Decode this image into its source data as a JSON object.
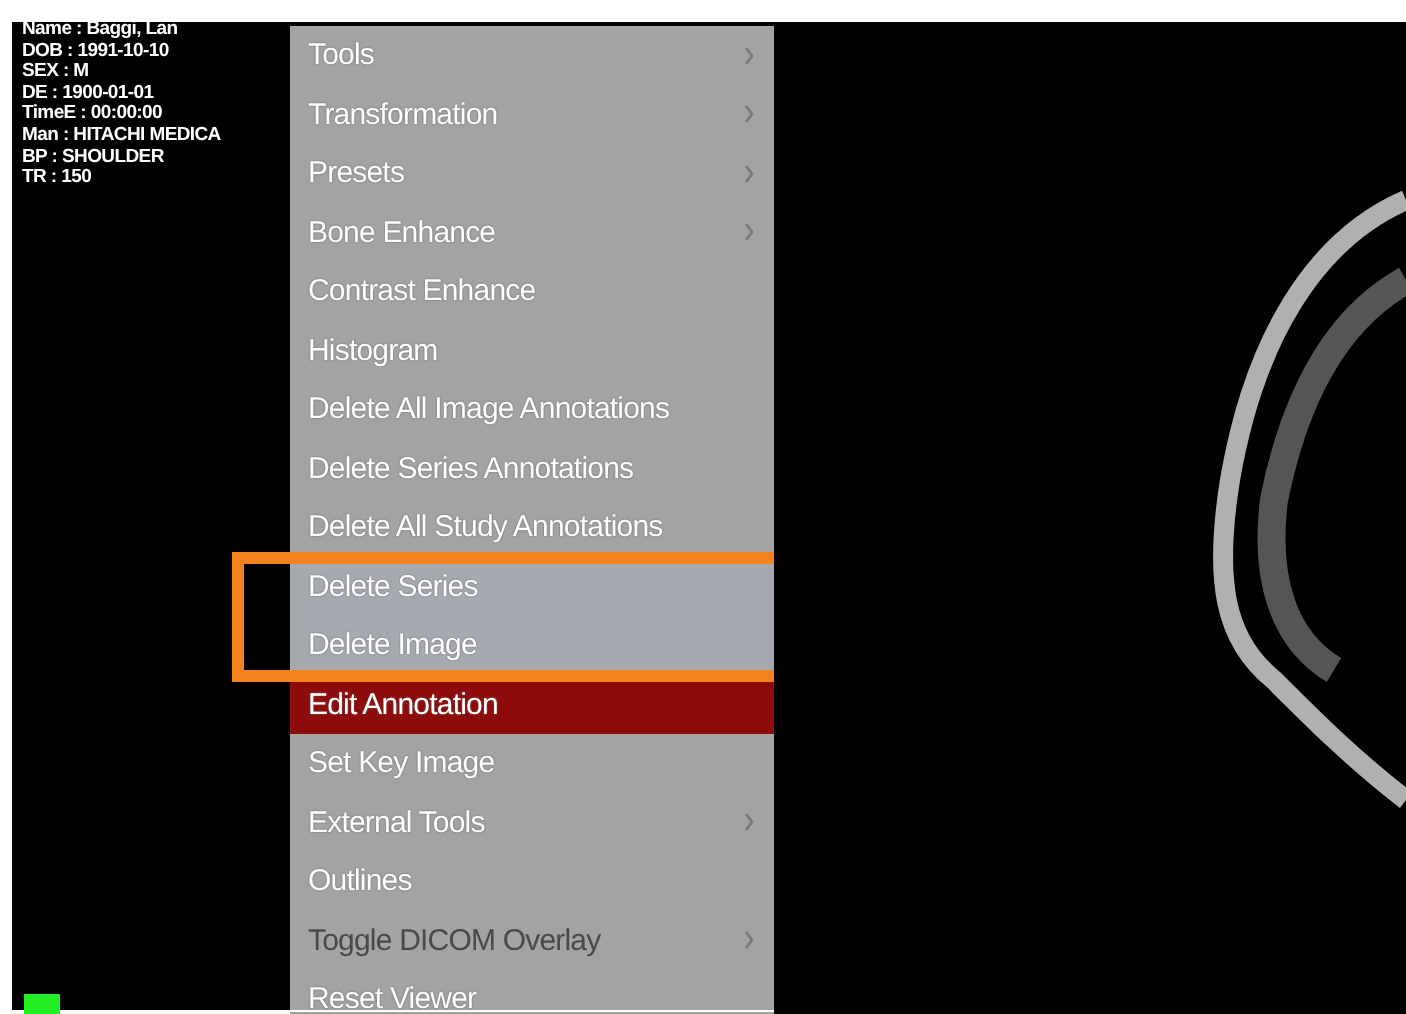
{
  "patient_overlay": {
    "lines": [
      "Name : Baggi, Lan",
      "DOB : 1991-10-10",
      "SEX : M",
      "DE : 1900-01-01",
      "TimeE : 00:00:00",
      "Man : HITACHI MEDICA",
      "BP : SHOULDER",
      "TR : 150"
    ]
  },
  "context_menu": {
    "items": [
      {
        "label": "Tools",
        "has_submenu": true,
        "selected": false,
        "disabled": false,
        "highlighted": false
      },
      {
        "label": "Transformation",
        "has_submenu": true,
        "selected": false,
        "disabled": false,
        "highlighted": false
      },
      {
        "label": "Presets",
        "has_submenu": true,
        "selected": false,
        "disabled": false,
        "highlighted": false
      },
      {
        "label": "Bone Enhance",
        "has_submenu": true,
        "selected": false,
        "disabled": false,
        "highlighted": false
      },
      {
        "label": "Contrast Enhance",
        "has_submenu": false,
        "selected": false,
        "disabled": false,
        "highlighted": false
      },
      {
        "label": "Histogram",
        "has_submenu": false,
        "selected": false,
        "disabled": false,
        "highlighted": false
      },
      {
        "label": "Delete All Image Annotations",
        "has_submenu": false,
        "selected": false,
        "disabled": false,
        "highlighted": false
      },
      {
        "label": "Delete Series Annotations",
        "has_submenu": false,
        "selected": false,
        "disabled": false,
        "highlighted": false
      },
      {
        "label": "Delete All Study Annotations",
        "has_submenu": false,
        "selected": false,
        "disabled": false,
        "highlighted": false
      },
      {
        "label": "Delete Series",
        "has_submenu": false,
        "selected": false,
        "disabled": false,
        "highlighted": true
      },
      {
        "label": "Delete Image",
        "has_submenu": false,
        "selected": false,
        "disabled": false,
        "highlighted": true
      },
      {
        "label": "Edit Annotation",
        "has_submenu": false,
        "selected": true,
        "disabled": false,
        "highlighted": false
      },
      {
        "label": "Set Key Image",
        "has_submenu": false,
        "selected": false,
        "disabled": false,
        "highlighted": false
      },
      {
        "label": "External Tools",
        "has_submenu": true,
        "selected": false,
        "disabled": false,
        "highlighted": false
      },
      {
        "label": "Outlines",
        "has_submenu": false,
        "selected": false,
        "disabled": false,
        "highlighted": false
      },
      {
        "label": "Toggle DICOM Overlay",
        "has_submenu": true,
        "selected": false,
        "disabled": true,
        "highlighted": false
      },
      {
        "label": "Reset Viewer",
        "has_submenu": false,
        "selected": false,
        "disabled": false,
        "highlighted": false
      }
    ]
  },
  "status_indicator": {
    "color": "#22ee22"
  }
}
